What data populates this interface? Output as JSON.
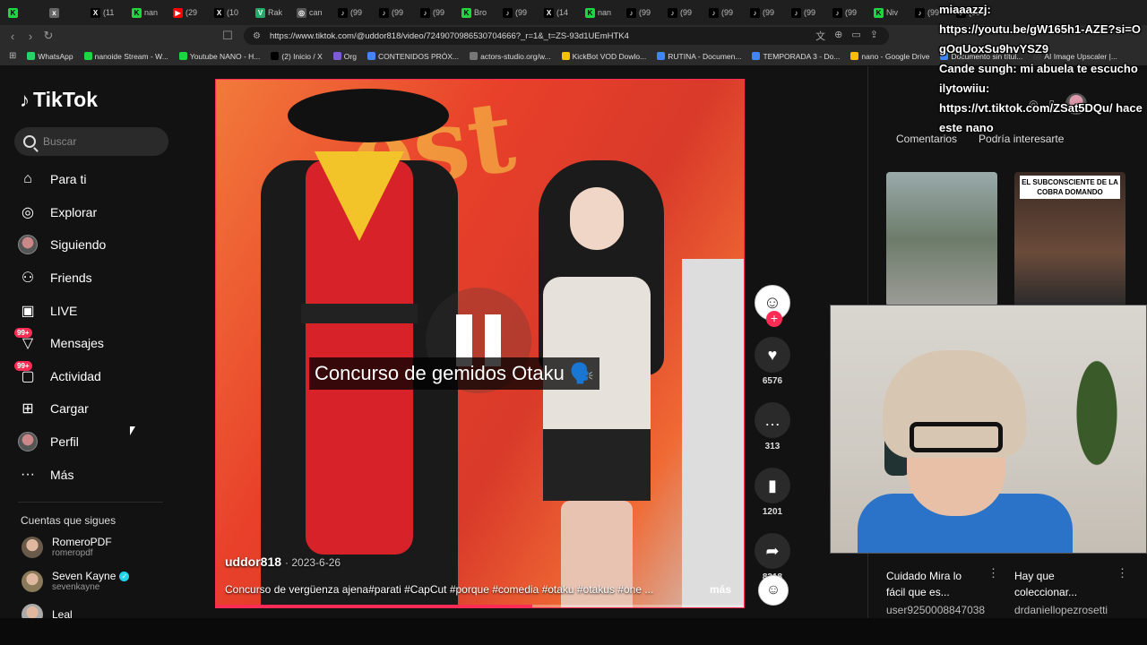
{
  "browser": {
    "tabs": [
      {
        "label": "",
        "fav_color": "#1bd741",
        "fav_glyph": "K"
      },
      {
        "label": "",
        "fav_color": "#666",
        "fav_glyph": "x"
      },
      {
        "label": "(11",
        "fav_color": "#000",
        "fav_glyph": "X"
      },
      {
        "label": "nan",
        "fav_color": "#1bd741",
        "fav_glyph": "K"
      },
      {
        "label": "(29",
        "fav_color": "#f00",
        "fav_glyph": "▶"
      },
      {
        "label": "(10",
        "fav_color": "#000",
        "fav_glyph": "X"
      },
      {
        "label": "Rak",
        "fav_color": "#2a6",
        "fav_glyph": "V"
      },
      {
        "label": "can",
        "fav_color": "#555",
        "fav_glyph": "◎"
      },
      {
        "label": "(99",
        "fav_color": "#000",
        "fav_glyph": "♪"
      },
      {
        "label": "(99",
        "fav_color": "#000",
        "fav_glyph": "♪"
      },
      {
        "label": "(99",
        "fav_color": "#000",
        "fav_glyph": "♪"
      },
      {
        "label": "Bro",
        "fav_color": "#1bd741",
        "fav_glyph": "K"
      },
      {
        "label": "(99",
        "fav_color": "#000",
        "fav_glyph": "♪"
      },
      {
        "label": "(14",
        "fav_color": "#000",
        "fav_glyph": "X"
      },
      {
        "label": "nan",
        "fav_color": "#1bd741",
        "fav_glyph": "K"
      },
      {
        "label": "(99",
        "fav_color": "#000",
        "fav_glyph": "♪"
      },
      {
        "label": "(99",
        "fav_color": "#000",
        "fav_glyph": "♪"
      },
      {
        "label": "(99",
        "fav_color": "#000",
        "fav_glyph": "♪"
      },
      {
        "label": "(99",
        "fav_color": "#000",
        "fav_glyph": "♪"
      },
      {
        "label": "(99",
        "fav_color": "#000",
        "fav_glyph": "♪"
      },
      {
        "label": "(99",
        "fav_color": "#000",
        "fav_glyph": "♪"
      },
      {
        "label": "Niv",
        "fav_color": "#1bd741",
        "fav_glyph": "K"
      },
      {
        "label": "(99",
        "fav_color": "#000",
        "fav_glyph": "♪"
      },
      {
        "label": "(99",
        "fav_color": "#000",
        "fav_glyph": "♪"
      }
    ],
    "url": "https://www.tiktok.com/@uddor818/video/7249070986530704666?_r=1&_t=ZS-93d1UEmHTK4",
    "bookmarks": [
      {
        "label": "WhatsApp",
        "color": "#25d366"
      },
      {
        "label": "nanoide Stream - W...",
        "color": "#1bd741"
      },
      {
        "label": "Youtube NANO - H...",
        "color": "#1bd741"
      },
      {
        "label": "(2) Inicio / X",
        "color": "#000"
      },
      {
        "label": "Org",
        "color": "#7b5cd6"
      },
      {
        "label": "CONTENIDOS PRÓX...",
        "color": "#4285f4"
      },
      {
        "label": "actors-studio.org/w...",
        "color": "#777"
      },
      {
        "label": "KickBot VOD Dowlo...",
        "color": "#f5c400"
      },
      {
        "label": "RUTINA - Documen...",
        "color": "#4285f4"
      },
      {
        "label": "TEMPORADA 3 - Do...",
        "color": "#4285f4"
      },
      {
        "label": "nano - Google Drive",
        "color": "#fbbc04"
      },
      {
        "label": "Documento sin títul...",
        "color": "#4285f4"
      },
      {
        "label": "AI Image Upscaler |...",
        "color": "#333"
      }
    ]
  },
  "tiktok": {
    "logo": "TikTok",
    "search_placeholder": "Buscar",
    "nav": [
      {
        "label": "Para ti",
        "icon": "home-icon",
        "glyph": "⌂"
      },
      {
        "label": "Explorar",
        "icon": "compass-icon",
        "glyph": "◎"
      },
      {
        "label": "Siguiendo",
        "icon": "avatar-icon",
        "glyph": ""
      },
      {
        "label": "Friends",
        "icon": "friends-icon",
        "glyph": "⚇"
      },
      {
        "label": "LIVE",
        "icon": "live-icon",
        "glyph": "▣"
      },
      {
        "label": "Mensajes",
        "icon": "messages-icon",
        "glyph": "▽",
        "badge": "99+"
      },
      {
        "label": "Actividad",
        "icon": "activity-icon",
        "glyph": "▢",
        "badge": "99+"
      },
      {
        "label": "Cargar",
        "icon": "upload-icon",
        "glyph": "⊞"
      },
      {
        "label": "Perfil",
        "icon": "profile-icon",
        "glyph": ""
      },
      {
        "label": "Más",
        "icon": "more-icon",
        "glyph": "···"
      }
    ],
    "following_title": "Cuentas que sigues",
    "following": [
      {
        "name": "RomeroPDF",
        "handle": "romeropdf",
        "verified": false,
        "color": "#6a5a4a"
      },
      {
        "name": "Seven Kayne",
        "handle": "sevenkayne",
        "verified": true,
        "color": "#8a7a5a"
      },
      {
        "name": "Leal",
        "handle": "",
        "verified": false,
        "color": "#aaa"
      }
    ]
  },
  "video": {
    "overlay_caption": "Concurso de gemidos Otaku 🗣️",
    "author": "uddor818",
    "date": "· 2023-6-26",
    "description": "Concurso de vergüenza ajena#parati #CapCut #porque #comedia #otaku #otakus #one ...",
    "more_label": "más",
    "progress": 0.6,
    "state": "paused"
  },
  "actions": {
    "likes": "6576",
    "comments": "313",
    "saves": "1201",
    "shares": "8218"
  },
  "right_panel": {
    "tabs": [
      "Comentarios",
      "Podría interesarte"
    ],
    "thumb2_title": "EL SUBCONSCIENTE DE LA COBRA DOMANDO",
    "recs": [
      {
        "title": "Cuidado Mira lo fácil que es...",
        "user": "user9250008847038"
      },
      {
        "title": "Hay que coleccionar...",
        "user": "drdaniellopezrosetti"
      }
    ]
  },
  "chat": [
    "miaaazzj:",
    "https://youtu.be/gW165h1-AZE?si=OgOqUoxSu9hvYSZ9",
    "Cande sungh: mi abuela te escucho",
    "ilytowiiu:",
    "https://vt.tiktok.com/ZSat5DQu/ hace este nano"
  ]
}
